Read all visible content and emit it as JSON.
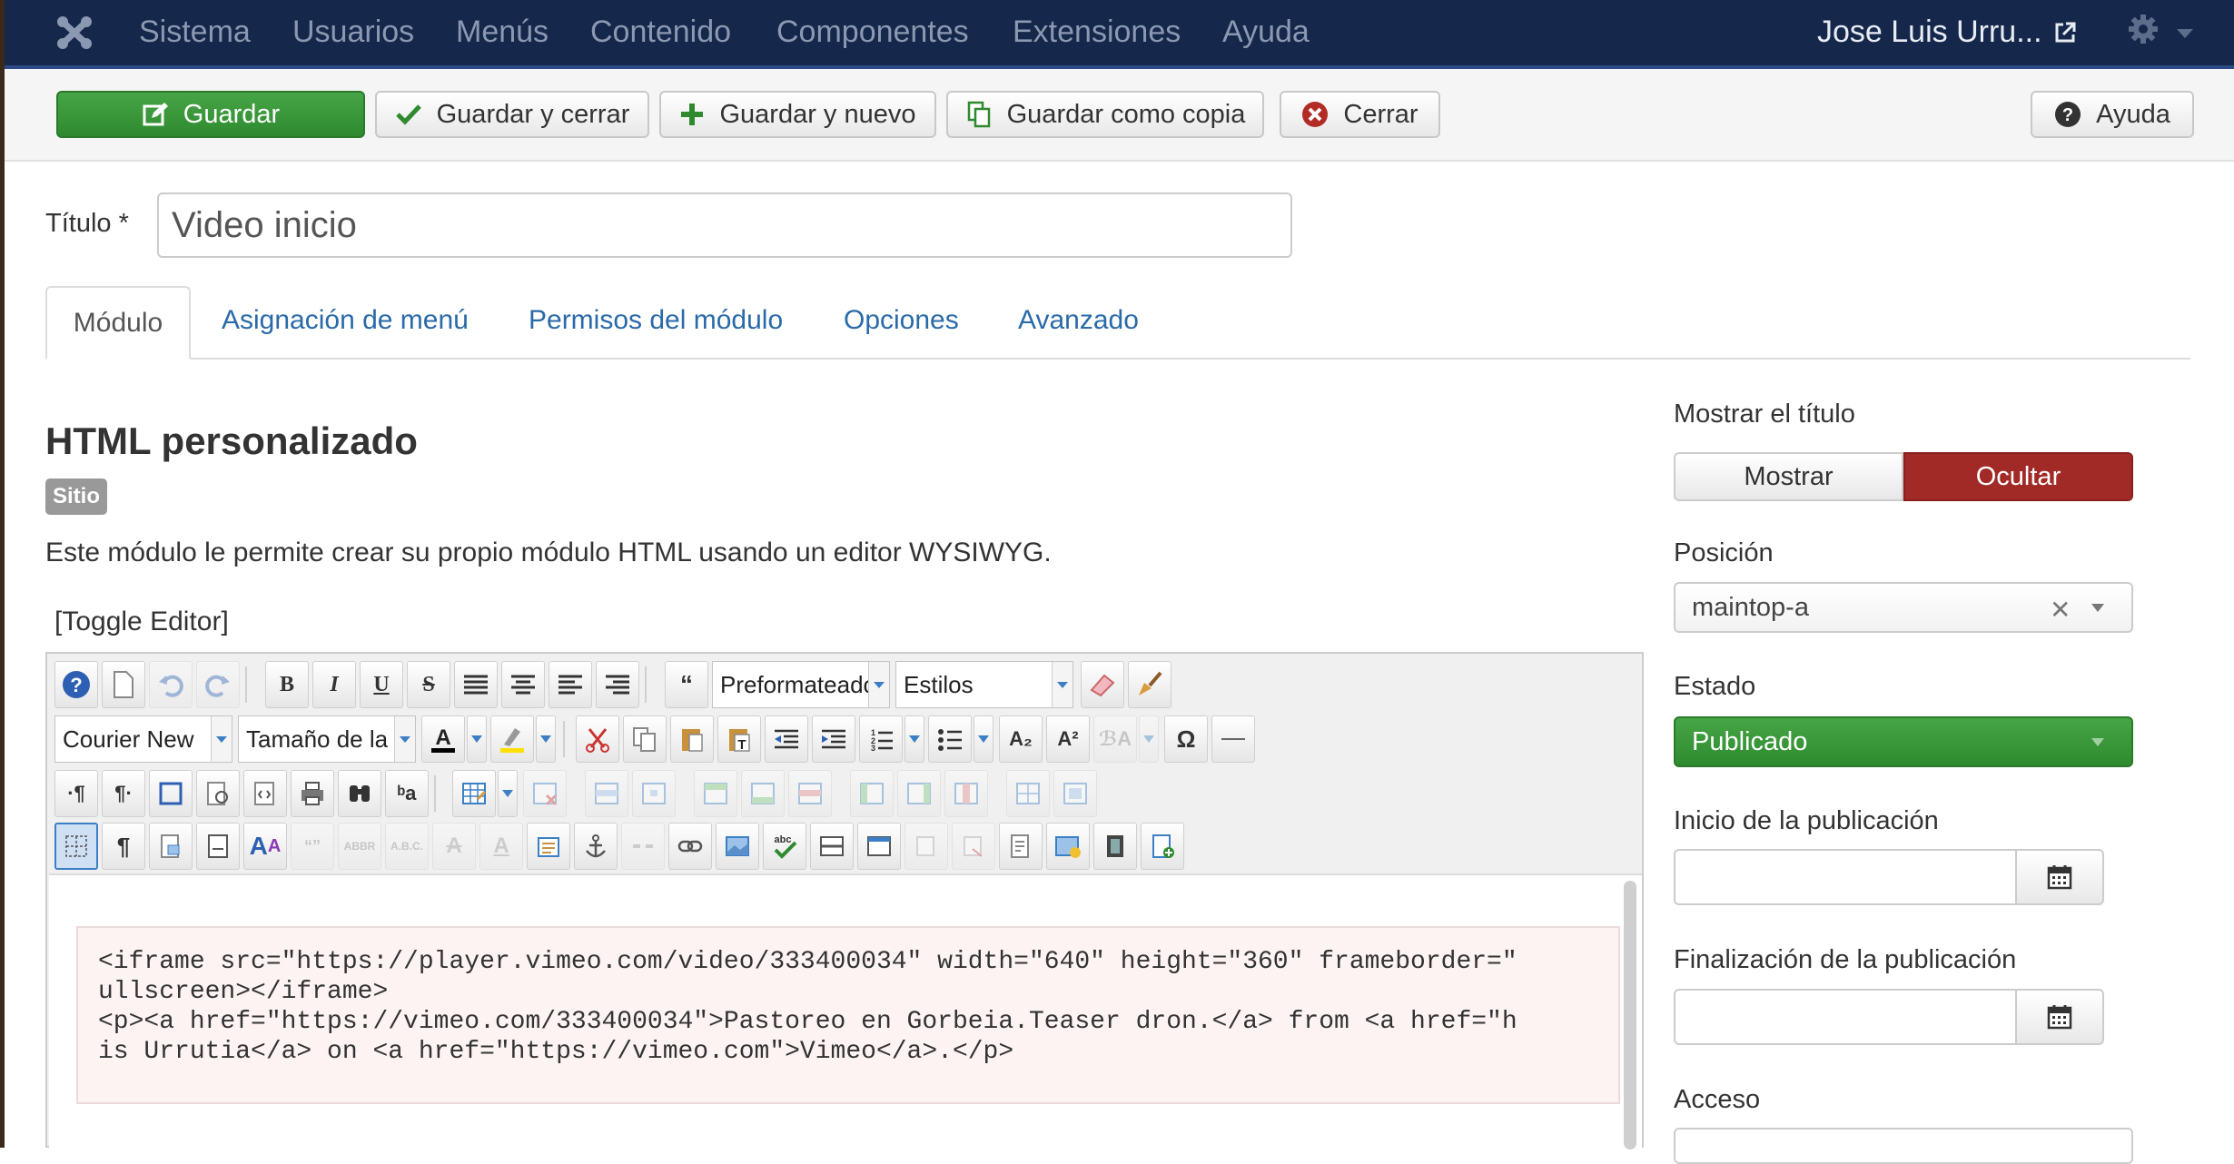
{
  "navbar": {
    "items": [
      "Sistema",
      "Usuarios",
      "Menús",
      "Contenido",
      "Componentes",
      "Extensiones",
      "Ayuda"
    ],
    "user": "Jose Luis Urru...",
    "icons": {
      "logo": "joomla-logo-icon",
      "external": "external-link-icon",
      "settings": "gear-icon"
    }
  },
  "toolbar": {
    "save": "Guardar",
    "save_close": "Guardar y cerrar",
    "save_new": "Guardar y nuevo",
    "save_copy": "Guardar como copia",
    "close": "Cerrar",
    "help": "Ayuda"
  },
  "form": {
    "title_label": "Título *",
    "title_value": "Video inicio"
  },
  "tabs": [
    "Módulo",
    "Asignación de menú",
    "Permisos del módulo",
    "Opciones",
    "Avanzado"
  ],
  "module": {
    "heading": "HTML personalizado",
    "badge": "Sitio",
    "description": "Este módulo le permite crear su propio módulo HTML usando un editor WYSIWYG.",
    "toggle_editor": "[Toggle Editor]"
  },
  "editor": {
    "format_select": "Preformateado",
    "styles_select": "Estilos",
    "font_select": "Courier New",
    "size_select": "Tamaño de la",
    "code_lines": [
      "<iframe src=\"https://player.vimeo.com/video/333400034\" width=\"640\" height=\"360\" frameborder=\"",
      "ullscreen></iframe>",
      "<p><a href=\"https://vimeo.com/333400034\">Pastoreo en Gorbeia.Teaser dron.</a> from <a href=\"h",
      "is Urrutia</a> on <a href=\"https://vimeo.com\">Vimeo</a>.</p>"
    ]
  },
  "sidebar": {
    "show_title_label": "Mostrar el título",
    "show_option": "Mostrar",
    "hide_option": "Ocultar",
    "position_label": "Posición",
    "position_value": "maintop-a",
    "state_label": "Estado",
    "state_value": "Publicado",
    "publish_up_label": "Inicio de la publicación",
    "publish_down_label": "Finalización de la publicación",
    "access_label": "Acceso"
  },
  "colors": {
    "navbar": "#15274a",
    "save_green": "#3a9a3a",
    "hide_red": "#a12a26",
    "link_blue": "#2a6aa8",
    "state_green": "#3a9a3a"
  }
}
